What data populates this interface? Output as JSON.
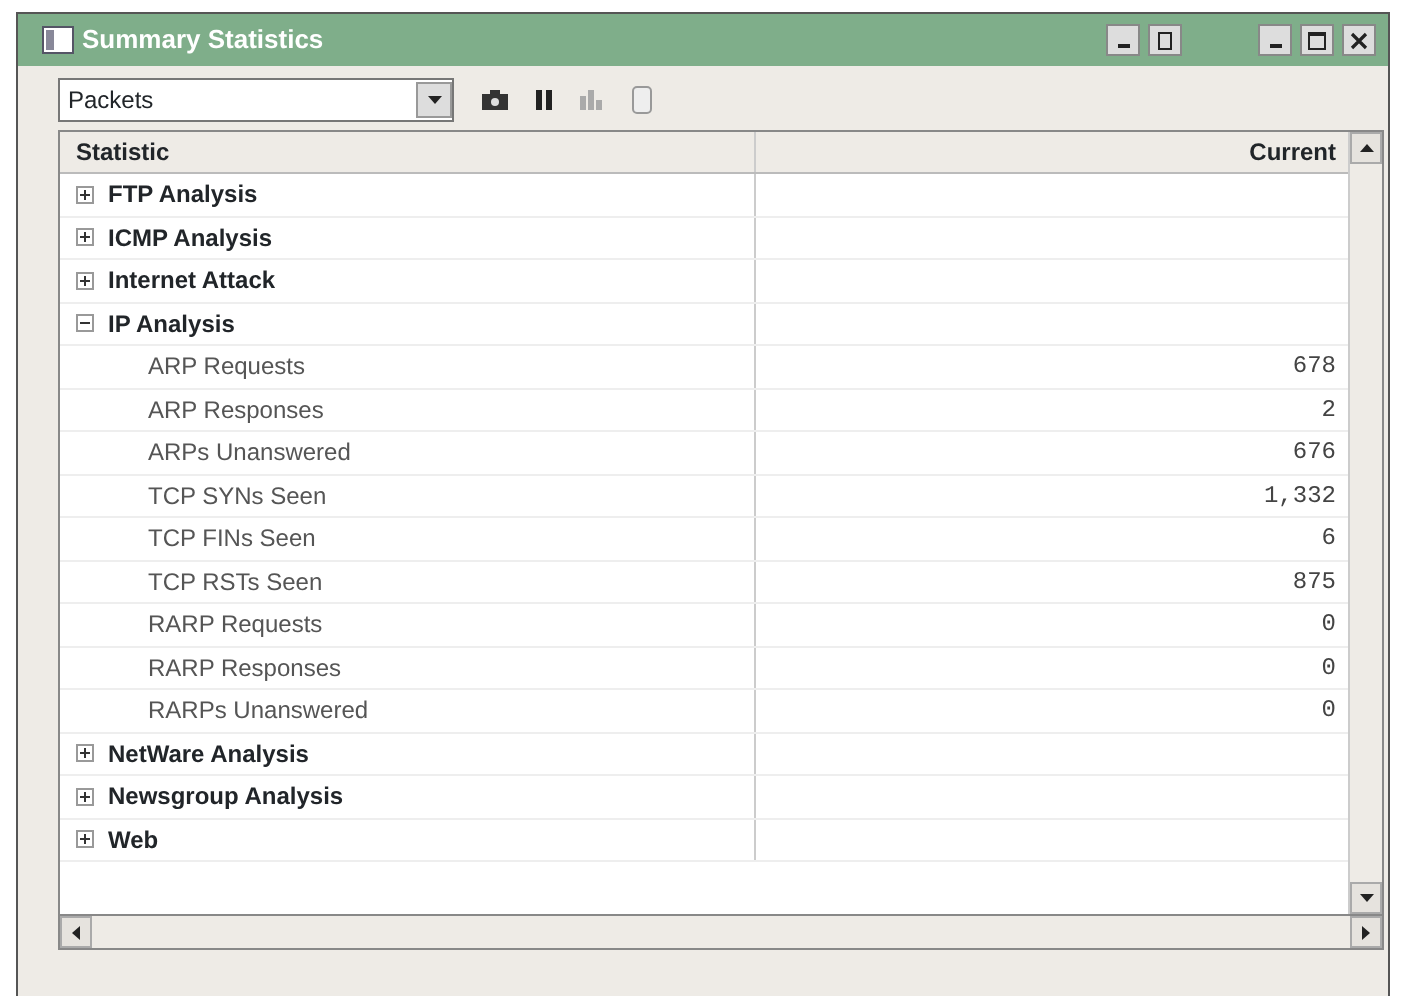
{
  "window": {
    "title": "Summary Statistics"
  },
  "toolbar": {
    "dropdown": {
      "value": "Packets"
    }
  },
  "table": {
    "columns": [
      "Statistic",
      "Current"
    ],
    "rows": [
      {
        "label": "FTP Analysis",
        "expanded": false
      },
      {
        "label": "ICMP Analysis",
        "expanded": false
      },
      {
        "label": "Internet Attack",
        "expanded": false
      },
      {
        "label": "IP Analysis",
        "expanded": true,
        "children": [
          {
            "label": "ARP Requests",
            "value": "678"
          },
          {
            "label": "ARP Responses",
            "value": "2"
          },
          {
            "label": "ARPs Unanswered",
            "value": "676"
          },
          {
            "label": "TCP SYNs Seen",
            "value": "1,332"
          },
          {
            "label": "TCP FINs Seen",
            "value": "6"
          },
          {
            "label": "TCP RSTs Seen",
            "value": "875"
          },
          {
            "label": "RARP Requests",
            "value": "0"
          },
          {
            "label": "RARP Responses",
            "value": "0"
          },
          {
            "label": "RARPs Unanswered",
            "value": "0"
          }
        ]
      },
      {
        "label": "NetWare Analysis",
        "expanded": false
      },
      {
        "label": "Newsgroup Analysis",
        "expanded": false
      },
      {
        "label": "Web",
        "expanded": false
      }
    ]
  }
}
